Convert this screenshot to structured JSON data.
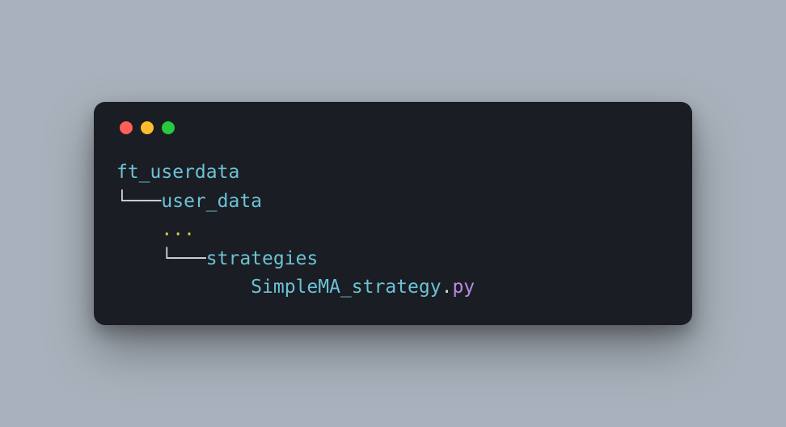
{
  "tree": {
    "line1": "ft_userdata",
    "line2_tree": "└───",
    "line2_name": "user_data",
    "line3_indent": "    ",
    "line3_dots": "...",
    "line4_indent": "    ",
    "line4_tree": "└───",
    "line4_name": "strategies",
    "line5_indent": "            ",
    "line5_filename": "SimpleMA_strategy",
    "line5_dot": ".",
    "line5_ext": "py"
  }
}
